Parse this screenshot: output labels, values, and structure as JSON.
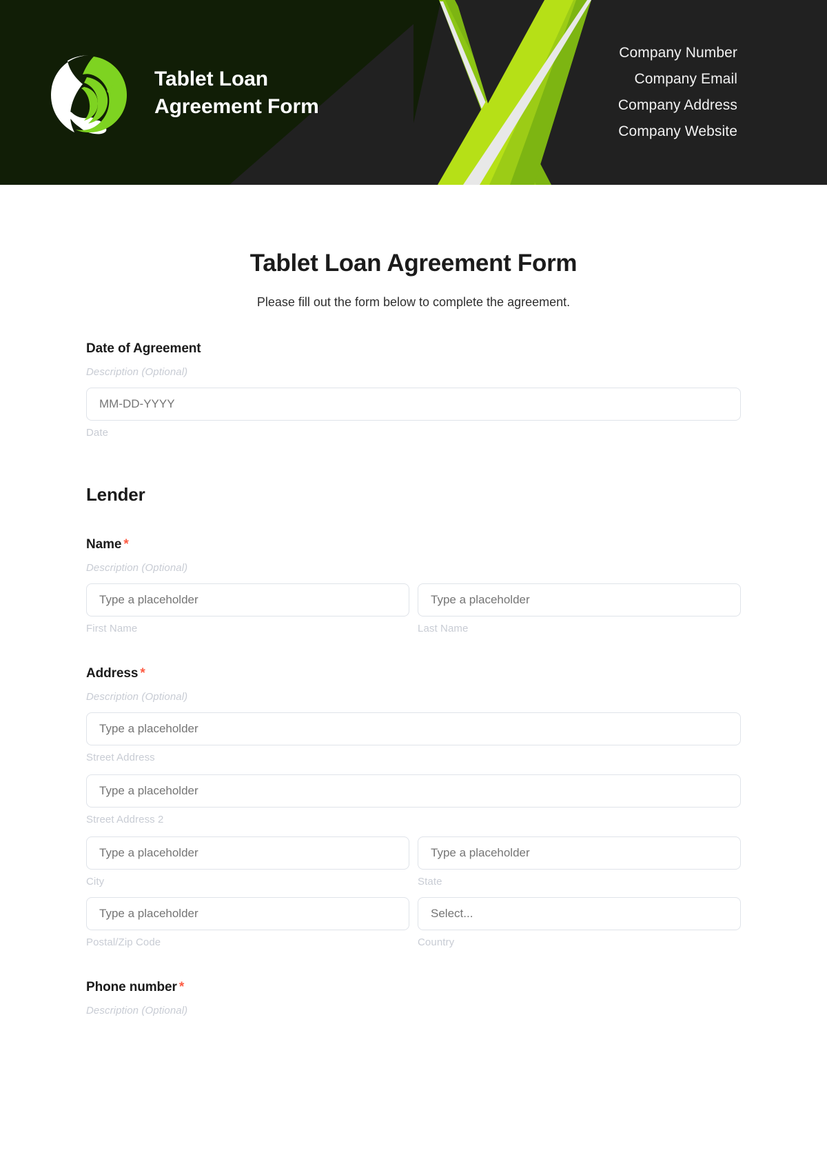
{
  "header": {
    "logo_title": "Tablet Loan\nAgreement Form",
    "logo_icon": "hands-circle-logo-icon",
    "contact": [
      "Company Number",
      "Company Email",
      "Company Address",
      "Company Website"
    ],
    "colors": {
      "background_dark": "#212121",
      "background_left": "#111e06",
      "accent_green": "#8cc514",
      "accent_light_green": "#b6e017",
      "accent_white": "#e8e8e8"
    }
  },
  "form": {
    "title": "Tablet Loan Agreement Form",
    "subtitle": "Please fill out the form below to complete the agreement.",
    "required_marker": "*",
    "description_placeholder": "Description (Optional)",
    "text_placeholder": "Type a placeholder",
    "select_placeholder": "Select...",
    "date_placeholder": "MM-DD-YYYY",
    "fields": [
      {
        "label": "Date of Agreement",
        "required": false,
        "description": "Description (Optional)",
        "sub_label": "Date"
      }
    ],
    "sections": [
      {
        "heading": "Lender",
        "fields": [
          {
            "label": "Name",
            "required": true,
            "description": "Description (Optional)",
            "columns": [
              {
                "placeholder": "Type a placeholder",
                "sub_label": "First Name"
              },
              {
                "placeholder": "Type a placeholder",
                "sub_label": "Last Name"
              }
            ]
          },
          {
            "label": "Address",
            "required": true,
            "description": "Description (Optional)",
            "rows": [
              {
                "placeholder": "Type a placeholder",
                "sub_label": "Street Address"
              },
              {
                "placeholder": "Type a placeholder",
                "sub_label": "Street Address 2"
              }
            ],
            "pairs": [
              [
                {
                  "placeholder": "Type a placeholder",
                  "sub_label": "City"
                },
                {
                  "placeholder": "Type a placeholder",
                  "sub_label": "State"
                }
              ],
              [
                {
                  "placeholder": "Type a placeholder",
                  "sub_label": "Postal/Zip Code"
                },
                {
                  "placeholder": "Select...",
                  "sub_label": "Country",
                  "type": "select"
                }
              ]
            ]
          },
          {
            "label": "Phone number",
            "required": true,
            "description": "Description (Optional)"
          }
        ]
      }
    ]
  }
}
